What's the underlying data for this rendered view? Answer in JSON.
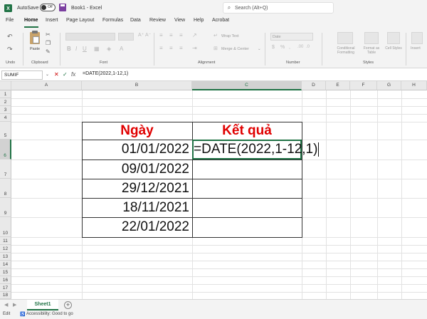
{
  "titlebar": {
    "autosave_label": "AutoSave",
    "autosave_state": "Off",
    "doc_title": "Book1 - Excel",
    "search_placeholder": "Search (Alt+Q)"
  },
  "tabs": [
    "File",
    "Home",
    "Insert",
    "Page Layout",
    "Formulas",
    "Data",
    "Review",
    "View",
    "Help",
    "Acrobat"
  ],
  "active_tab": "Home",
  "ribbon": {
    "undo_group": "Undo",
    "paste_label": "Paste",
    "clipboard_group": "Clipboard",
    "font_group": "Font",
    "alignment_group": "Alignment",
    "number_group": "Number",
    "styles_group": "Styles",
    "wrap_text": "Wrap Text",
    "merge_center": "Merge & Center",
    "number_format": "Date",
    "conditional_formatting": "Conditional Formatting",
    "format_as_table": "Format as Table",
    "cell_styles": "Cell Styles",
    "insert_label": "Insert"
  },
  "formula_bar": {
    "name_box": "SUMIF",
    "formula": "=DATE(2022,1-12,1)"
  },
  "grid": {
    "columns": [
      "A",
      "B",
      "C",
      "D",
      "E",
      "F",
      "G",
      "H"
    ],
    "rows": [
      "1",
      "2",
      "3",
      "4",
      "5",
      "6",
      "7",
      "8",
      "9",
      "10",
      "11",
      "12",
      "13",
      "14",
      "15",
      "16",
      "17",
      "18",
      "19"
    ],
    "active_column": "C",
    "active_row": "6"
  },
  "table": {
    "header_date": "Ngày",
    "header_result": "Kết quả",
    "dates": [
      "01/01/2022",
      "09/01/2022",
      "29/12/2021",
      "18/11/2021",
      "22/01/2022"
    ],
    "editing_formula": "=DATE(2022,1-12,1)"
  },
  "sheets": [
    "Sheet1"
  ],
  "status": {
    "mode": "Edit",
    "accessibility": "Accessibility: Good to go"
  },
  "colors": {
    "excel_green": "#217346",
    "header_red": "#e00000"
  }
}
